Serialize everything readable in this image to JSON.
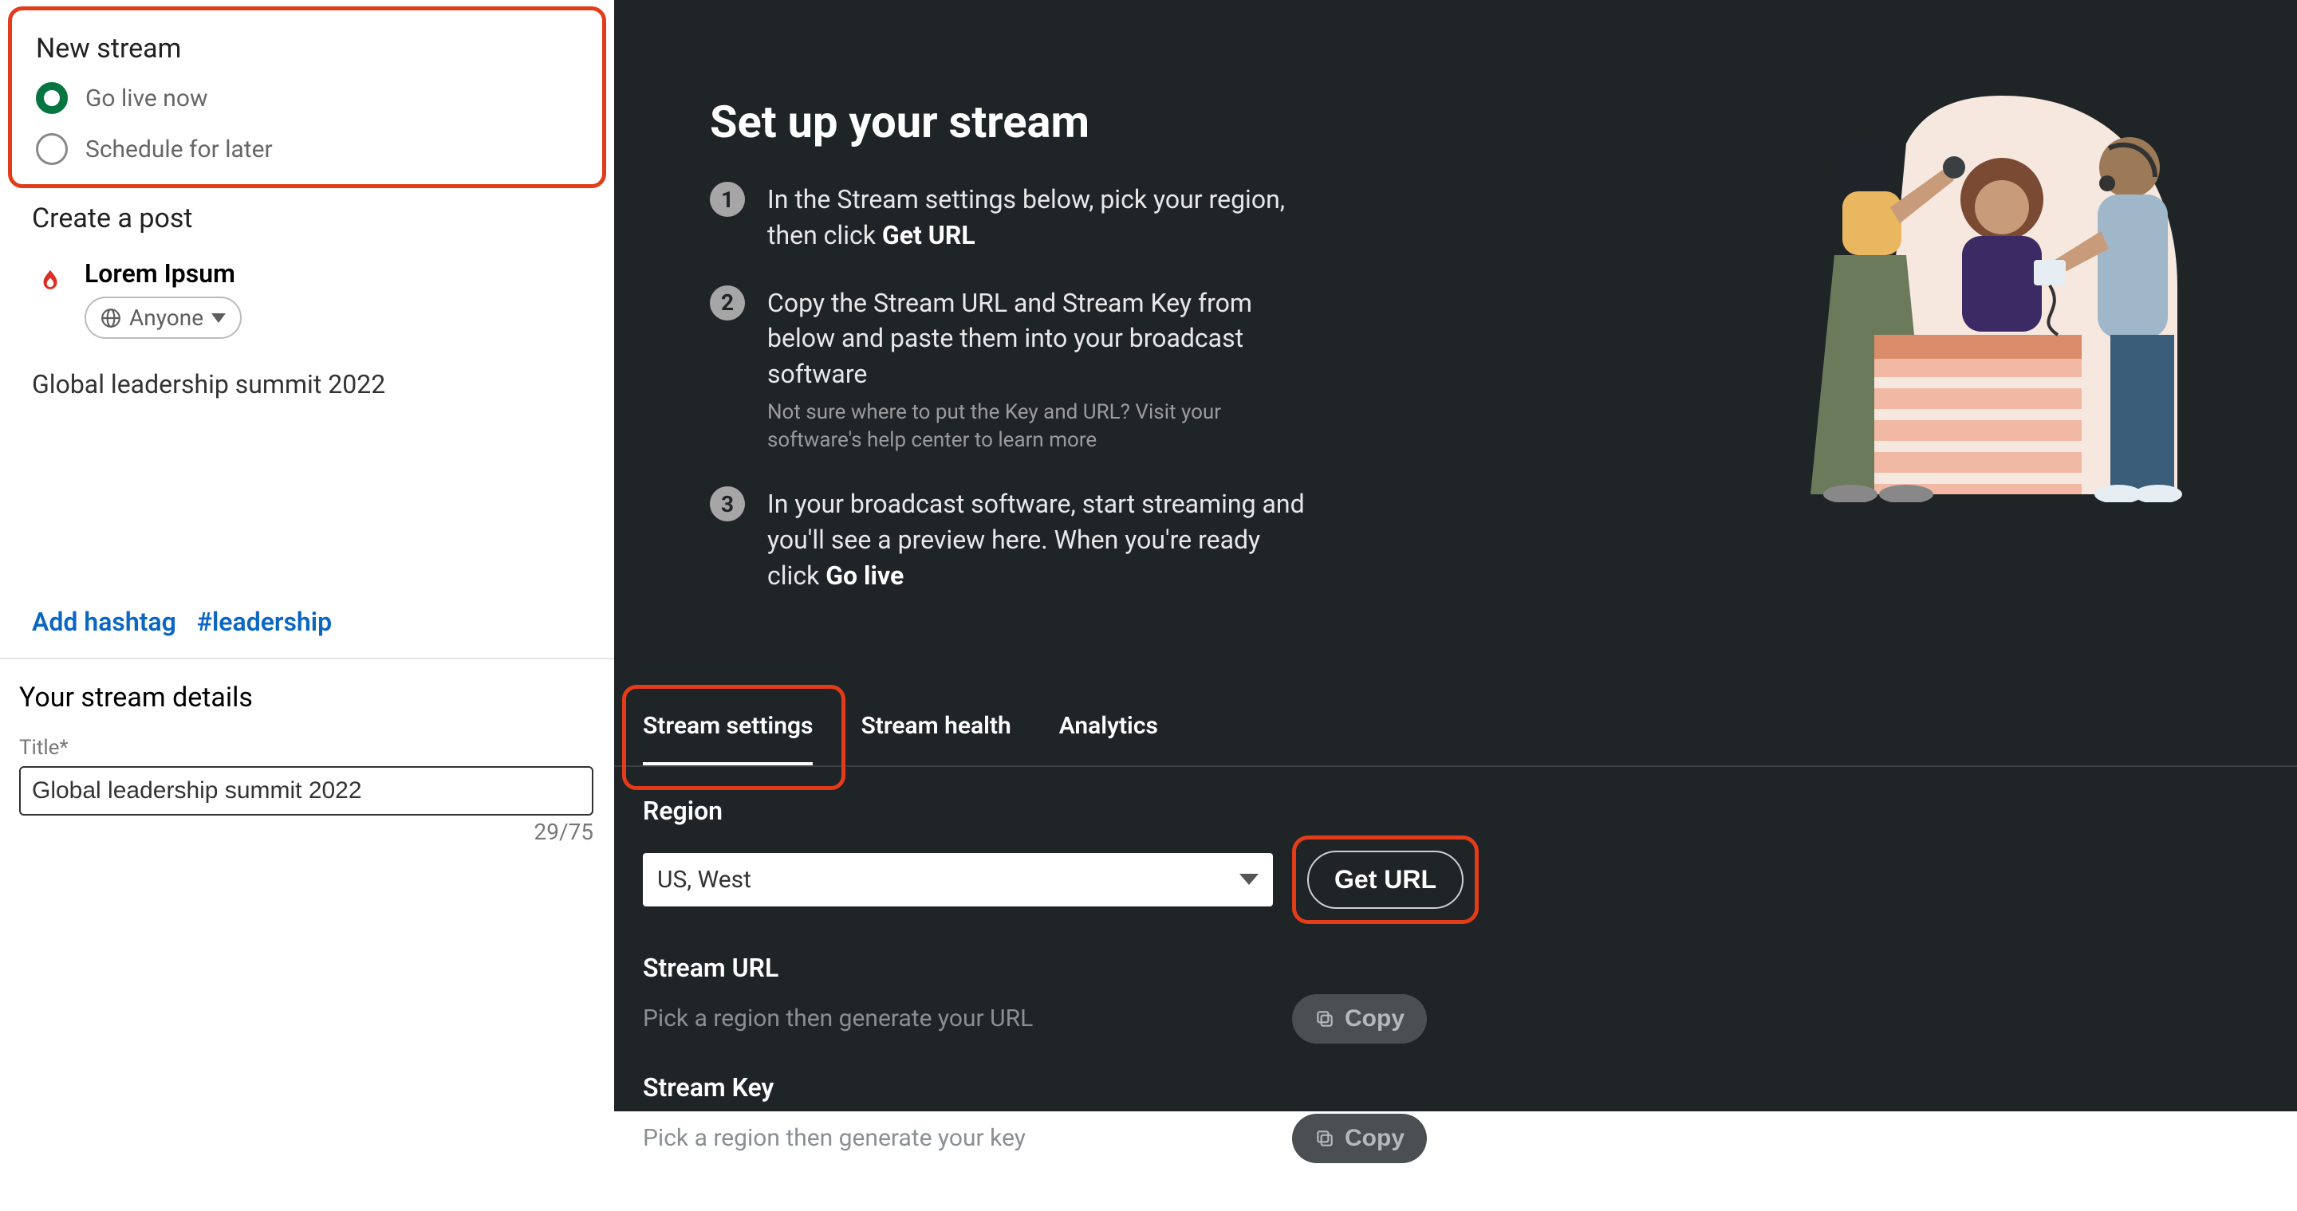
{
  "sidebar": {
    "new_stream_title": "New stream",
    "radio_live": "Go live now",
    "radio_schedule": "Schedule for later",
    "create_post_title": "Create a post",
    "poster_name": "Lorem Ipsum",
    "audience_label": "Anyone",
    "post_text": "Global leadership summit 2022",
    "add_hashtag": "Add hashtag",
    "suggested_hashtag": "#leadership",
    "details_title": "Your stream details",
    "title_label": "Title*",
    "title_value": "Global leadership summit 2022",
    "title_count": "29/75"
  },
  "main": {
    "hero_title": "Set up your stream",
    "steps": [
      {
        "n": "1",
        "text_a": "In the Stream settings below, pick your region, then click ",
        "bold": "Get URL",
        "text_b": ""
      },
      {
        "n": "2",
        "text_a": "Copy the Stream URL and Stream Key from below and paste them into your broadcast software",
        "bold": "",
        "text_b": "",
        "help": "Not sure where to put the Key and URL? Visit your software's help center to learn more"
      },
      {
        "n": "3",
        "text_a": "In your broadcast software, start streaming and you'll see a preview here. When you're ready click ",
        "bold": "Go live",
        "text_b": ""
      }
    ],
    "tabs": {
      "settings": "Stream settings",
      "health": "Stream health",
      "analytics": "Analytics"
    },
    "settings": {
      "region_label": "Region",
      "region_value": "US, West",
      "get_url": "Get URL",
      "url_label": "Stream URL",
      "url_placeholder": "Pick a region then generate your URL",
      "key_label": "Stream Key",
      "key_placeholder": "Pick a region then generate your key",
      "copy": "Copy"
    }
  }
}
